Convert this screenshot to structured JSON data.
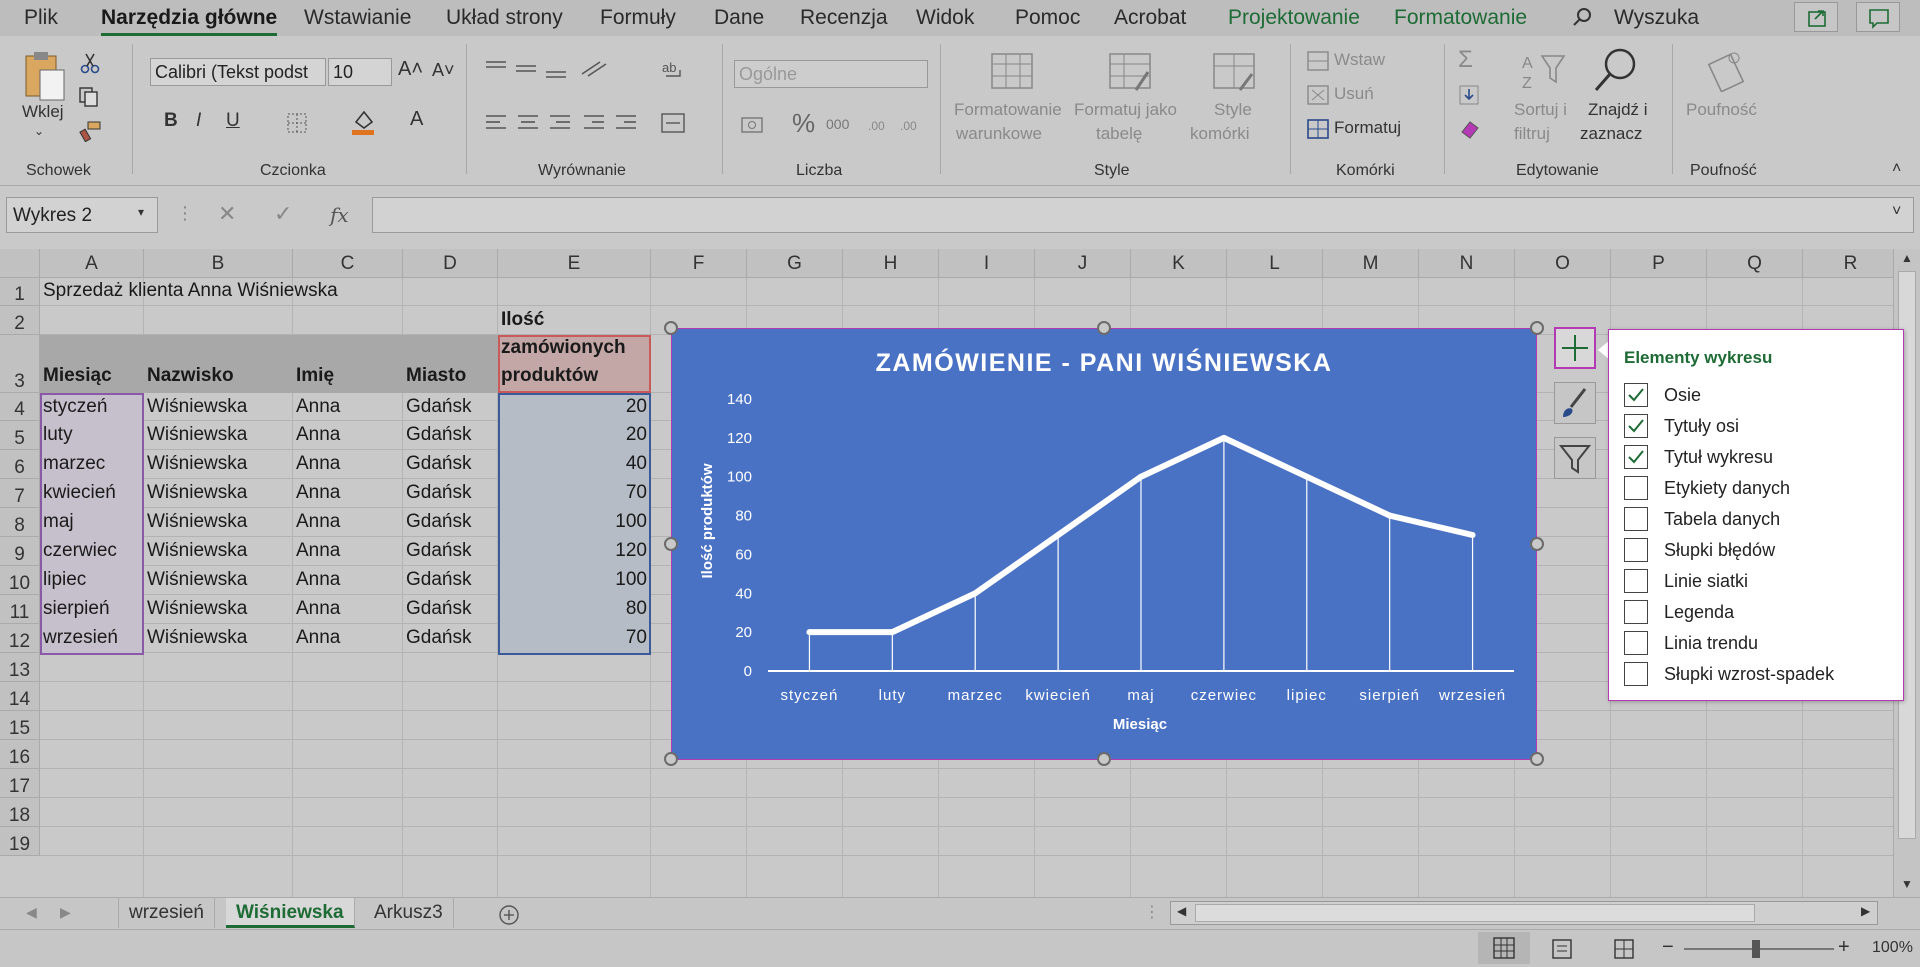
{
  "menu": {
    "tabs": [
      "Plik",
      "Narzędzia główne",
      "Wstawianie",
      "Układ strony",
      "Formuły",
      "Dane",
      "Recenzja",
      "Widok",
      "Pomoc",
      "Acrobat",
      "Projektowanie",
      "Formatowanie"
    ],
    "active_tab": "Narzędzia główne",
    "search_label": "Wyszuka"
  },
  "ribbon": {
    "clipboard": {
      "paste": "Wklej",
      "group": "Schowek"
    },
    "font": {
      "name": "Calibri (Tekst podst",
      "size": "10",
      "bold": "B",
      "italic": "I",
      "underline": "U",
      "color_letter": "A",
      "group": "Czcionka"
    },
    "alignment": {
      "group": "Wyrównanie"
    },
    "number": {
      "format": "Ogólne",
      "percent": "%",
      "thousands": "000",
      "group": "Liczba"
    },
    "styles": {
      "conditional": [
        "Formatowanie",
        "warunkowe"
      ],
      "as_table": [
        "Formatuj jako",
        "tabelę"
      ],
      "cell_styles": [
        "Style",
        "komórki"
      ],
      "group": "Style"
    },
    "cells": {
      "insert": "Wstaw",
      "delete": "Usuń",
      "format": "Formatuj",
      "group": "Komórki"
    },
    "editing": {
      "sort": [
        "Sortuj i",
        "filtruj"
      ],
      "find": [
        "Znajdź i",
        "zaznacz"
      ],
      "group": "Edytowanie"
    },
    "sensitivity": {
      "label": "Poufność",
      "group": "Poufność"
    }
  },
  "formula_bar": {
    "name_box": "Wykres 2",
    "fx": "fx"
  },
  "columns": [
    "A",
    "B",
    "C",
    "D",
    "E",
    "F",
    "G",
    "H",
    "I",
    "J",
    "K",
    "L",
    "M",
    "N",
    "O",
    "P",
    "Q",
    "R"
  ],
  "rows": [
    "1",
    "2",
    "3",
    "4",
    "5",
    "6",
    "7",
    "8",
    "9",
    "10",
    "11",
    "12",
    "13",
    "14",
    "15",
    "16",
    "17",
    "18",
    "19"
  ],
  "sheet": {
    "a1": "Sprzedaż klienta Anna Wiśniewska",
    "headers": [
      "Miesiąc",
      "Nazwisko",
      "Imię",
      "Miasto",
      "Ilość",
      "zamówionych",
      "produktów"
    ],
    "data": [
      [
        "styczeń",
        "Wiśniewska",
        "Anna",
        "Gdańsk",
        "20"
      ],
      [
        "luty",
        "Wiśniewska",
        "Anna",
        "Gdańsk",
        "20"
      ],
      [
        "marzec",
        "Wiśniewska",
        "Anna",
        "Gdańsk",
        "40"
      ],
      [
        "kwiecień",
        "Wiśniewska",
        "Anna",
        "Gdańsk",
        "70"
      ],
      [
        "maj",
        "Wiśniewska",
        "Anna",
        "Gdańsk",
        "100"
      ],
      [
        "czerwiec",
        "Wiśniewska",
        "Anna",
        "Gdańsk",
        "120"
      ],
      [
        "lipiec",
        "Wiśniewska",
        "Anna",
        "Gdańsk",
        "100"
      ],
      [
        "sierpień",
        "Wiśniewska",
        "Anna",
        "Gdańsk",
        "80"
      ],
      [
        "wrzesień",
        "Wiśniewska",
        "Anna",
        "Gdańsk",
        "70"
      ]
    ]
  },
  "chart_data": {
    "type": "line",
    "title": "ZAMÓWIENIE - PANI WIŚNIEWSKA",
    "xlabel": "Miesiąc",
    "ylabel": "Ilość produktów",
    "categories": [
      "styczeń",
      "luty",
      "marzec",
      "kwiecień",
      "maj",
      "czerwiec",
      "lipiec",
      "sierpień",
      "wrzesień"
    ],
    "values": [
      20,
      20,
      40,
      70,
      100,
      120,
      100,
      80,
      70
    ],
    "yticks": [
      "0",
      "20",
      "40",
      "60",
      "80",
      "100",
      "120",
      "140"
    ],
    "ylim": [
      0,
      140
    ],
    "grid": false,
    "drop_lines": true,
    "colors": {
      "background": "#4a72c4",
      "line": "#ffffff"
    }
  },
  "chart_elements": {
    "title": "Elementy wykresu",
    "items": [
      {
        "label": "Osie",
        "checked": true
      },
      {
        "label": "Tytuły osi",
        "checked": true
      },
      {
        "label": "Tytuł wykresu",
        "checked": true
      },
      {
        "label": "Etykiety danych",
        "checked": false
      },
      {
        "label": "Tabela danych",
        "checked": false
      },
      {
        "label": "Słupki błędów",
        "checked": false
      },
      {
        "label": "Linie siatki",
        "checked": false
      },
      {
        "label": "Legenda",
        "checked": false
      },
      {
        "label": "Linia trendu",
        "checked": false
      },
      {
        "label": "Słupki wzrost-spadek",
        "checked": false
      }
    ]
  },
  "sheet_tabs": [
    "wrzesień",
    "Wiśniewska",
    "Arkusz3"
  ],
  "active_sheet": "Wiśniewska",
  "status": {
    "zoom": "100%"
  },
  "colors": {
    "accent_green": "#1e6b36",
    "selection_magenta": "#b43ab4"
  }
}
